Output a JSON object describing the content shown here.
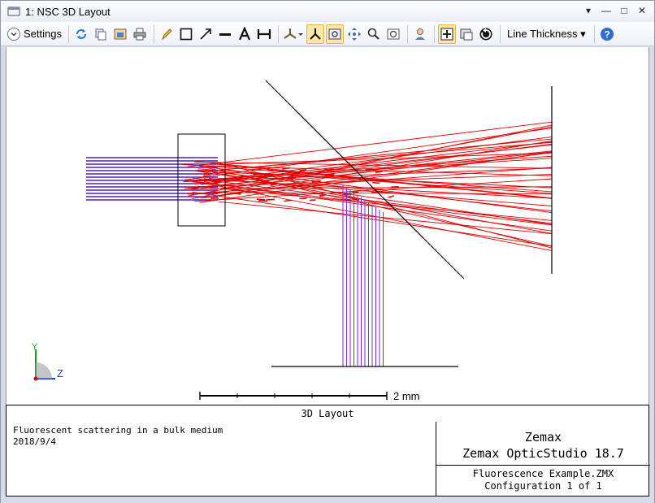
{
  "window": {
    "title": "1: NSC 3D Layout",
    "controls": [
      "▾",
      "—",
      "□",
      "✕"
    ]
  },
  "toolbar": {
    "settings_label": "Settings",
    "line_thickness_label": "Line Thickness ▾",
    "icons": [
      "refresh-icon",
      "copy-icon",
      "save-image-icon",
      "print-icon",
      "pencil-icon",
      "rectangle-icon",
      "arrow-icon",
      "line-icon",
      "text-icon",
      "dimension-icon",
      "axes-dropdown-icon",
      "orient-icon",
      "zoom-window-icon",
      "pan-icon",
      "zoom-icon",
      "reset-view-icon",
      "user-icon",
      "fit-icon",
      "export-icon",
      "rotate-icon",
      "help-icon"
    ]
  },
  "layout": {
    "axis_y_label": "Y",
    "axis_z_label": "Z",
    "scale_label": "2 mm",
    "colors": {
      "ray_blue": "#4b1fd0",
      "ray_red": "#e00000",
      "ray_purple": "#7a2ad8"
    }
  },
  "footer": {
    "caption": "3D Layout",
    "description": "Fluorescent scattering in a bulk medium",
    "date": "2018/9/4",
    "company": "Zemax",
    "product": "Zemax OpticStudio 18.7",
    "file": "Fluorescence Example.ZMX",
    "configuration": "Configuration 1 of 1"
  }
}
